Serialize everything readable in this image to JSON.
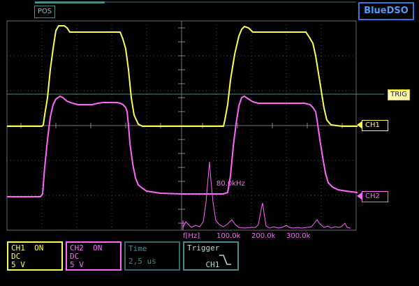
{
  "app": {
    "brand": "BlueDSO",
    "pos_label": "POS"
  },
  "markers": {
    "trigger": "TRIG",
    "ch1": "CH1",
    "ch2": "CH2"
  },
  "fft": {
    "peak_label": "80.0kHz",
    "axis_unit": "f[Hz]",
    "ticks": [
      "100.0k",
      "200.0k",
      "300.0k"
    ]
  },
  "panels": {
    "ch1": {
      "name": "CH1",
      "state": "ON",
      "coupling": "DC",
      "scale": "5 V"
    },
    "ch2": {
      "name": "CH2",
      "state": "ON",
      "coupling": "DC",
      "scale": "5 V"
    },
    "time": {
      "title": "Time",
      "value": "2,5 us"
    },
    "trigger": {
      "title": "Trigger",
      "source": "CH1"
    }
  },
  "colors": {
    "ch1": "#ffff50",
    "ch2": "#ff66ff",
    "grid": "#5a5a5a",
    "accent": "#4a8b8b",
    "brand": "#2f78d8"
  }
}
